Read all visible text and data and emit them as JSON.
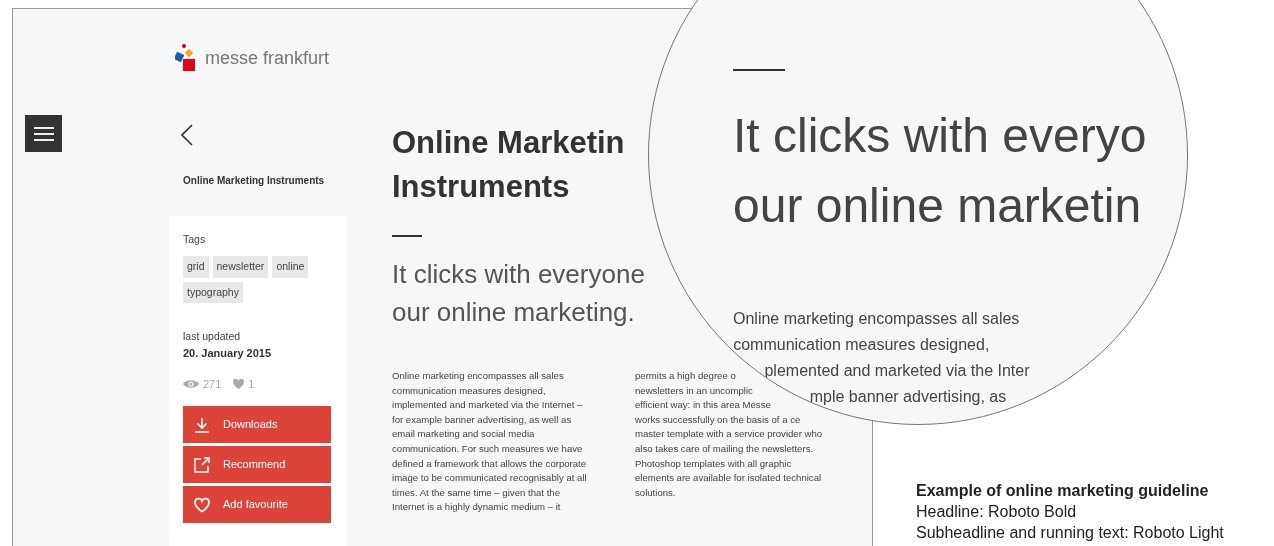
{
  "logo": {
    "text": "messe frankfurt"
  },
  "sidebar": {
    "title": "Online Marketing Instruments",
    "tags_label": "Tags",
    "tags": [
      "grid",
      "newsletter",
      "online",
      "typography"
    ],
    "updated_label": "last updated",
    "updated_date": "20. January 2015",
    "views": "271",
    "likes": "1",
    "actions": [
      {
        "kind": "download",
        "label": "Downloads"
      },
      {
        "kind": "share",
        "label": "Recommend"
      },
      {
        "kind": "favourite",
        "label": "Add favourite"
      }
    ]
  },
  "article": {
    "headline_lines": [
      "Online Marketin",
      "Instruments"
    ],
    "subheadline_lines": [
      "It clicks with everyone",
      "our online marketing."
    ],
    "column_1": [
      "Online marketing encompasses all sales",
      "communication measures designed,",
      "implemented and marketed via the Internet –",
      "for example banner advertising, as well as",
      "email marketing and social media",
      "communication. For such measures we have",
      "defined a framework that allows the corporate",
      "image to be communicated recognisably at all",
      "times. At the same time – given that the",
      "Internet is a highly dynamic medium – it"
    ],
    "column_2": [
      "permits a high degree o",
      "newsletters in an uncomplic",
      "efficient way: in this area Messe",
      "works successfully on the basis of a ce",
      "master template with a service provider who",
      "also takes care of mailing the newsletters.",
      "Photoshop templates with all graphic",
      "elements are available for isolated technical",
      "solutions."
    ]
  },
  "magnifier": {
    "subheadline_lines": [
      "It clicks with everyo",
      "our online marketin"
    ],
    "body_lines": [
      "Online marketing encompasses all sales",
      "communication measures designed,",
      "plemented and marketed via the Inter",
      "mple banner advertising, as"
    ]
  },
  "caption": {
    "title": "Example of online marketing guideline",
    "lines": [
      "Headline: Roboto Bold",
      "Subheadline and running text: Roboto Light"
    ]
  }
}
